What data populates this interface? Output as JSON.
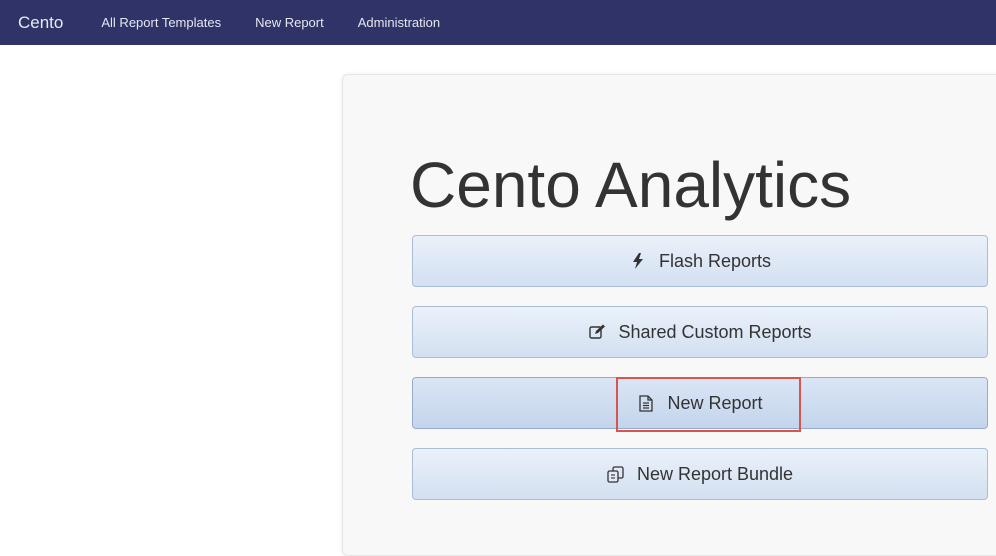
{
  "navbar": {
    "brand": "Cento",
    "links": [
      {
        "label": "All Report Templates"
      },
      {
        "label": "New Report"
      },
      {
        "label": "Administration"
      }
    ],
    "background": "#2f3368"
  },
  "main": {
    "title": "Cento Analytics",
    "buttons": [
      {
        "label": "Flash Reports",
        "icon": "bolt-icon"
      },
      {
        "label": "Shared Custom Reports",
        "icon": "edit-icon"
      },
      {
        "label": "New Report",
        "icon": "file-text-icon",
        "highlighted": true
      },
      {
        "label": "New Report Bundle",
        "icon": "copy-icon"
      }
    ]
  },
  "colors": {
    "button_gradient_top": "#eaf1fa",
    "button_gradient_bottom": "#d3e0f1",
    "button_border": "#a9bdd6",
    "highlight": "#d9534f"
  }
}
